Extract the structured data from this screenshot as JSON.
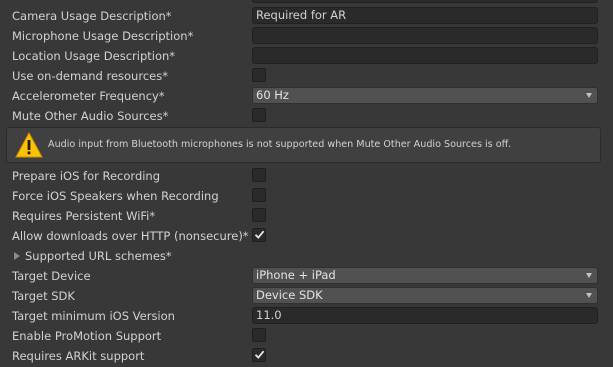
{
  "rows": {
    "camera": {
      "label": "Camera Usage Description*",
      "value": "Required for AR"
    },
    "microphone": {
      "label": "Microphone Usage Description*",
      "value": ""
    },
    "location": {
      "label": "Location Usage Description*",
      "value": ""
    },
    "on_demand": {
      "label": "Use on-demand resources*",
      "checked": false
    },
    "accelerometer": {
      "label": "Accelerometer Frequency*",
      "value": "60 Hz"
    },
    "mute_other": {
      "label": "Mute Other Audio Sources*",
      "checked": false
    },
    "prepare_ios": {
      "label": "Prepare iOS for Recording",
      "checked": false
    },
    "force_speakers": {
      "label": "Force iOS Speakers when Recording",
      "checked": false
    },
    "persistent_wifi": {
      "label": "Requires Persistent WiFi*",
      "checked": false
    },
    "allow_http": {
      "label": "Allow downloads over HTTP (nonsecure)*",
      "checked": true
    },
    "url_schemes": {
      "label": "Supported URL schemes*"
    },
    "target_device": {
      "label": "Target Device",
      "value": "iPhone + iPad"
    },
    "target_sdk": {
      "label": "Target SDK",
      "value": "Device SDK"
    },
    "target_min_ios": {
      "label": "Target minimum iOS Version",
      "value": "11.0"
    },
    "promotion": {
      "label": "Enable ProMotion Support",
      "checked": false
    },
    "arkit": {
      "label": "Requires ARKit support",
      "checked": true
    }
  },
  "help_box": {
    "icon": "warning-icon",
    "text": "Audio input from Bluetooth microphones is not supported when Mute Other Audio Sources is off."
  },
  "colors": {
    "background": "#383838",
    "field": "#2a2a2a",
    "dropdown": "#515151",
    "warning": "#ffc107"
  }
}
